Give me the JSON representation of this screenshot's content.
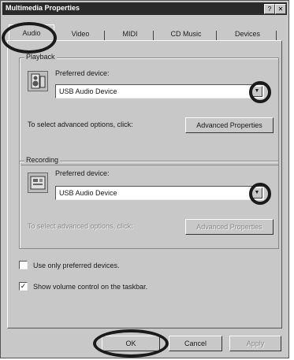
{
  "window": {
    "title": "Multimedia Properties",
    "help_glyph": "?",
    "close_glyph": "✕"
  },
  "tabs": [
    {
      "label": "Audio",
      "active": true
    },
    {
      "label": "Video"
    },
    {
      "label": "MIDI"
    },
    {
      "label": "CD Music"
    },
    {
      "label": "Devices"
    }
  ],
  "playback": {
    "group_label": "Playback",
    "preferred_label": "Preferred device:",
    "device_value": "USB Audio Device",
    "advanced_text": "To select advanced options, click:",
    "advanced_button": "Advanced Properties"
  },
  "recording": {
    "group_label": "Recording",
    "preferred_label": "Preferred device:",
    "device_value": "USB Audio Device",
    "advanced_text": "To select advanced options, click:",
    "advanced_button": "Advanced Properties"
  },
  "options": {
    "use_preferred_label": "Use only preferred devices.",
    "use_preferred_checked": false,
    "show_volume_label": "Show volume control on the taskbar.",
    "show_volume_checked": true
  },
  "buttons": {
    "ok": "OK",
    "cancel": "Cancel",
    "apply": "Apply"
  },
  "icons": {
    "dropdown": "▼",
    "check": "✓"
  }
}
